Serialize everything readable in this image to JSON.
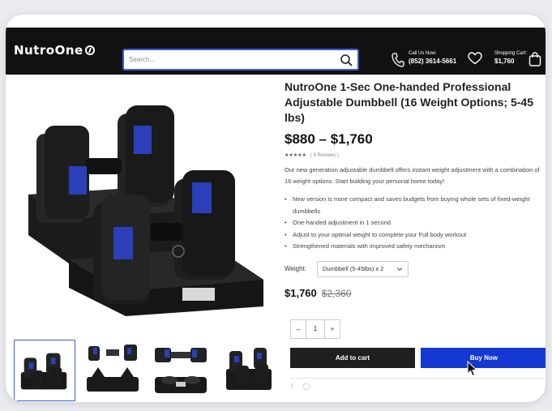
{
  "header": {
    "logo": "NutroOne",
    "search_placeholder": "Search...",
    "call_label": "Call Us Now:",
    "call_number": "(852) 3614-5661",
    "cart_label": "Shopping Cart:",
    "cart_value": "$1,760"
  },
  "product": {
    "title": "NutroOne 1-Sec One-handed Professional Adjustable Dumbbell (16 Weight Options; 5-45 lbs)",
    "price_range": "$880 – $1,760",
    "rating_stars": "★★★★★",
    "reviews": "( 9 Reviews )",
    "description": "Our new generation adjustable dumbbell offers instant weight adjustment with a combination of 16 weight options. Start building your personal home today!",
    "features": [
      "New version is more compact and saves budgets from buying whole sets of fixed-weight dumbbells",
      "One-handed adjustment in 1 second",
      "Adjust to your optimal weight to complete your Full body workout",
      "Strengthened materials with improved safety mechanism"
    ],
    "weight_label": "Weight:",
    "weight_selected": "Dumbbell (5-45lbs) x 2",
    "price_now": "$1,760",
    "price_old": "$2,360",
    "quantity": "1",
    "qty_minus": "–",
    "qty_plus": "+",
    "add_to_cart": "Add to cart",
    "buy_now": "Buy Now",
    "share_facebook": "f",
    "share_whatsapp": "◯"
  },
  "colors": {
    "header_bg": "#111111",
    "accent_blue": "#1438d1",
    "dumbbell_accent": "#2a3fb8"
  }
}
